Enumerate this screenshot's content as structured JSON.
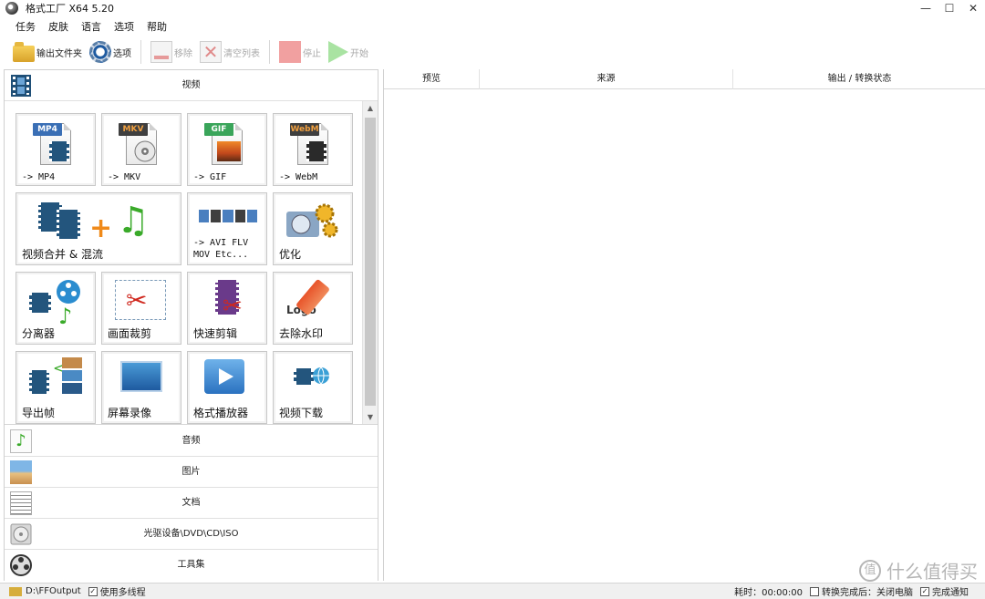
{
  "window": {
    "title": "格式工厂 X64 5.20",
    "minimize": "—",
    "maximize": "☐",
    "close": "✕"
  },
  "menu": [
    "任务",
    "皮肤",
    "语言",
    "选项",
    "帮助"
  ],
  "toolbar": {
    "output_folder": "输出文件夹",
    "options": "选项",
    "remove": "移除",
    "clear_list": "清空列表",
    "stop": "停止",
    "start": "开始"
  },
  "left": {
    "video_header": "视频",
    "tiles": [
      {
        "label": "-> MP4",
        "tag": "MP4",
        "tag_color": "#3a6fb5"
      },
      {
        "label": "-> MKV",
        "tag": "MKV",
        "tag_color": "#3f3f3f"
      },
      {
        "label": "-> GIF",
        "tag": "GIF",
        "tag_color": "#3aa55a"
      },
      {
        "label": "-> WebM",
        "tag": "WebM",
        "tag_color": "#3f3f3f"
      },
      {
        "label": "视频合并 & 混流"
      },
      {
        "label_line1": "-> AVI FLV",
        "label_line2": "MOV Etc..."
      },
      {
        "label": "优化"
      },
      {
        "label": "分离器"
      },
      {
        "label": "画面裁剪"
      },
      {
        "label": "快速剪辑"
      },
      {
        "label": "去除水印",
        "logo_text": "Logo"
      },
      {
        "label": "导出帧"
      },
      {
        "label": "屏幕录像"
      },
      {
        "label": "格式播放器"
      },
      {
        "label": "视频下载"
      }
    ],
    "scroll_up": "▲",
    "scroll_down": "▼",
    "categories": [
      "音频",
      "图片",
      "文档",
      "光驱设备\\DVD\\CD\\ISO",
      "工具集"
    ]
  },
  "table": {
    "columns": [
      "预览",
      "来源",
      "输出 / 转换状态"
    ]
  },
  "status": {
    "output_path": "D:\\FFOutput",
    "multithread": "使用多线程",
    "elapsed": "耗时：00:00:00",
    "after_done": "转换完成后：关闭电脑",
    "notify": "完成通知"
  },
  "watermark": {
    "logo": "值",
    "text": "什么值得买"
  }
}
